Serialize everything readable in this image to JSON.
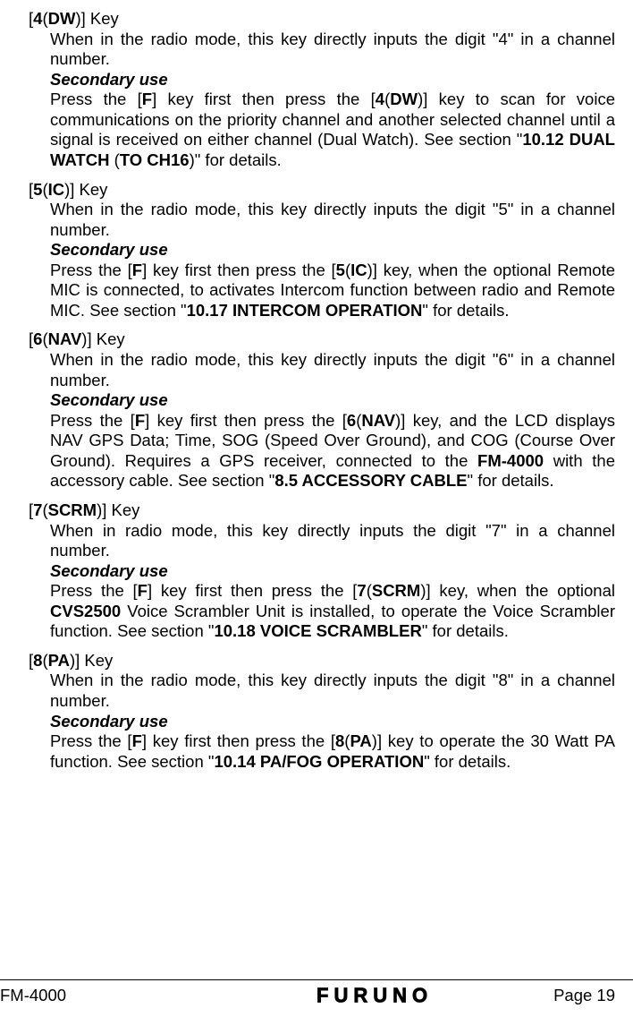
{
  "entries": [
    {
      "title_html": "[<b>4</b>(<b>DW</b>)] Key",
      "primary_html": "When in the radio mode, this key directly inputs the digit \"4\" in a channel number.",
      "secondary_label": "Secondary use",
      "secondary_html": "Press the [<b>F</b>] key first then press the [<b>4</b>(<b>DW</b>)] key to scan for voice communications on the priority channel and another selected channel until a signal is received on either channel (Dual Watch). See section \"<b>10.12 DUAL WATCH</b> (<b>TO CH16</b>)\" for details."
    },
    {
      "title_html": "[<b>5</b>(<b>IC</b>)] Key",
      "primary_html": "When in the radio mode, this key directly inputs the digit \"5\" in a channel number.",
      "secondary_label": "Secondary use",
      "secondary_html": "Press the [<b>F</b>] key first then press the [<b>5</b>(<b>IC</b>)] key, when the optional Remote MIC is connected, to activates Intercom function between radio and Remote MIC. See section \"<b>10.17 INTERCOM OPERATION</b>\" for details."
    },
    {
      "title_html": "[<b>6</b>(<b>NAV</b>)] Key",
      "primary_html": "When in the radio mode, this key directly inputs the digit \"6\" in a channel number.",
      "secondary_label": "Secondary use",
      "secondary_html": "Press the [<b>F</b>] key first then press the [<b>6</b>(<b>NAV</b>)] key, and the LCD displays NAV GPS Data; Time, SOG (Speed Over Ground), and COG (Course Over Ground). Requires a GPS receiver, connected to the <b>FM-4000</b> with the accessory cable. See section \"<b>8.5 ACCESSORY CABLE</b>\" for details."
    },
    {
      "title_html": "[<b>7</b>(<b>SCRM</b>)] Key",
      "primary_html": "When in radio mode, this key directly inputs the digit \"7\" in a channel number.",
      "secondary_label": "Secondary use",
      "secondary_html": "Press the [<b>F</b>] key first then press the [<b>7</b>(<b>SCRM</b>)] key, when the optional <b>CVS2500</b> Voice Scrambler Unit is installed, to operate the Voice Scrambler function. See section \"<b>10.18 VOICE SCRAMBLER</b>\" for details."
    },
    {
      "title_html": "[<b>8</b>(<b>PA</b>)] Key",
      "primary_html": "When in the radio mode, this key directly inputs the digit \"8\" in a channel number.",
      "secondary_label": "Secondary use",
      "secondary_html": "Press the [<b>F</b>] key first then press the [<b>8</b>(<b>PA</b>)] key to operate the 30 Watt PA function. See section \"<b>10.14 PA/FOG OPERATION</b>\" for details."
    }
  ],
  "footer": {
    "left": "FM-4000",
    "logo": "FURUNO",
    "right": "Page 19"
  }
}
